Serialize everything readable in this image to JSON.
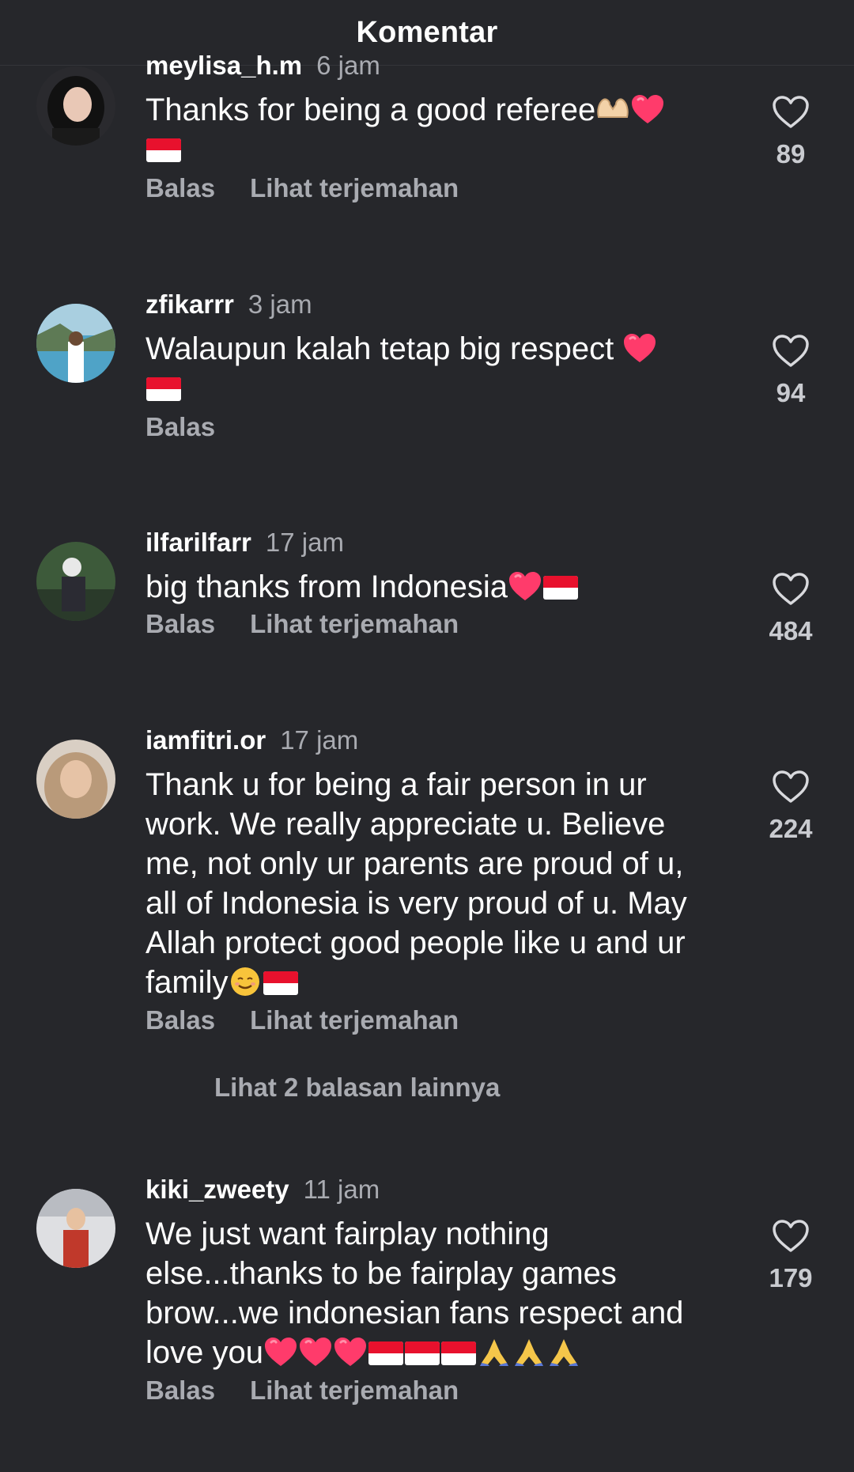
{
  "header": {
    "title": "Komentar"
  },
  "comments": [
    {
      "username": "meylisa_h.m",
      "time": "6 jam",
      "text": "Thanks for being a good referee",
      "likes": "89",
      "reply_label": "Balas",
      "translate_label": "Lihat terjemahan"
    },
    {
      "username": "zfikarrr",
      "time": "3 jam",
      "text": "Walaupun kalah tetap big respect ",
      "likes": "94",
      "reply_label": "Balas"
    },
    {
      "username": "ilfarilfarr",
      "time": "17 jam",
      "text": "big thanks from Indonesia",
      "likes": "484",
      "reply_label": "Balas",
      "translate_label": "Lihat terjemahan"
    },
    {
      "username": "iamfitri.or",
      "time": "17 jam",
      "text_lines": [
        "Thank u for being a fair person in ur",
        "work. We really appreciate u. Believe",
        "me, not only ur parents are proud of u,",
        "all of Indonesia is very proud of u. May",
        "Allah protect good people like u and ur",
        "family"
      ],
      "likes": "224",
      "reply_label": "Balas",
      "translate_label": "Lihat terjemahan",
      "more_replies": "Lihat 2 balasan lainnya"
    },
    {
      "username": "kiki_zweety",
      "time": "11 jam",
      "text_lines": [
        "We just want fairplay nothing",
        "else...thanks to be fairplay games",
        "brow...we indonesian fans respect and",
        "love you"
      ],
      "likes": "179",
      "reply_label": "Balas",
      "translate_label": "Lihat terjemahan"
    }
  ],
  "icons": {
    "like": "heart-outline-icon",
    "emoji_heart": "red-heart-emoji",
    "emoji_flag": "indonesia-flag-emoji",
    "emoji_hands": "heart-hands-emoji",
    "emoji_smile": "smiling-face-emoji",
    "emoji_pray": "folded-hands-emoji"
  },
  "colors": {
    "background": "#26272b",
    "text": "#ffffff",
    "muted": "#a9abb1",
    "heart": "#ff3b6b",
    "flag_red": "#e8112d"
  }
}
